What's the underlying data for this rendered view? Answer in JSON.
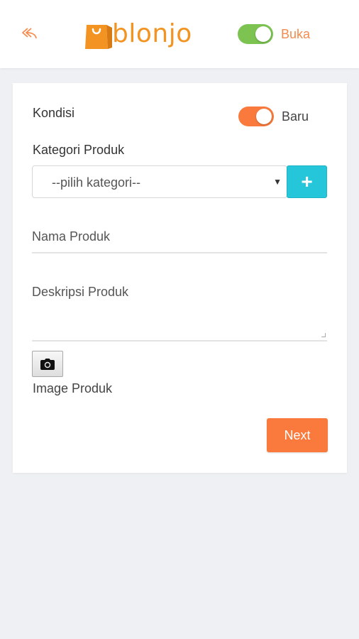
{
  "header": {
    "back_icon": "back-arrow-icon",
    "logo_text": "blonjo",
    "logo_icon": "shopping-bag-icon",
    "store_status_label": "Buka",
    "store_open": true,
    "toggle_color": "#7cc352",
    "label_color": "#f58a4c"
  },
  "form": {
    "kondisi_label": "Kondisi",
    "kondisi_value_label": "Baru",
    "kondisi_on": true,
    "kondisi_toggle_color": "#f97a3c",
    "kategori_label": "Kategori Produk",
    "kategori_select_value": "--pilih kategori--",
    "add_category_icon": "plus-icon",
    "nama_placeholder": "Nama Produk",
    "deskripsi_placeholder": "Deskripsi Produk",
    "camera_icon": "camera-icon",
    "image_label": "Image Produk",
    "next_label": "Next"
  },
  "colors": {
    "brand_orange": "#f29322",
    "accent_orange": "#f97a3c",
    "add_button": "#26c6da",
    "background": "#eef0f3"
  }
}
